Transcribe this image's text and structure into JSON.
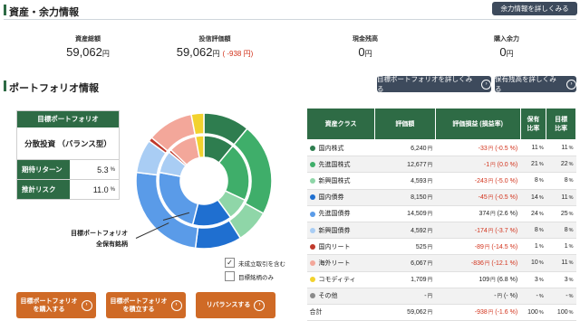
{
  "section1": {
    "title": "資産・余力情報",
    "detail_button": "余力情報を詳しくみる"
  },
  "summary": [
    {
      "label": "資産総額",
      "value": "59,062",
      "unit": "円",
      "extra": ""
    },
    {
      "label": "投信評価額",
      "value": "59,062",
      "unit": "円",
      "extra": "( -938 円)"
    },
    {
      "label": "現金残高",
      "value": "0",
      "unit": "円",
      "extra": ""
    },
    {
      "label": "購入余力",
      "value": "0",
      "unit": "円",
      "extra": ""
    }
  ],
  "section2": {
    "title": "ポートフォリオ情報",
    "detail_button": "目標ポートフォリオを詳しくみる",
    "holdings_button": "保有残高を詳しくみる"
  },
  "target": {
    "header": "目標ポートフォリオ",
    "name": "分散投資 （バランス型）",
    "return_label": "期待リターン",
    "return_value": "5.3",
    "risk_label": "推計リスク",
    "risk_value": "11.0",
    "pct": "%"
  },
  "donut_labels": {
    "outer": "目標ポートフォリオ",
    "inner": "全保有銘柄"
  },
  "checkboxes": [
    {
      "label": "未成立取引を含む",
      "checked": true
    },
    {
      "label": "目標銘柄のみ",
      "checked": false
    }
  ],
  "buttons": {
    "buy": "目標ポートフォリオ\nを購入する",
    "build": "目標ポートフォリオ\nを積立する",
    "rebalance": "リバランスする"
  },
  "table": {
    "headers": [
      "資産クラス",
      "評価額",
      "評価損益 (損益率)",
      "保有\n比率",
      "目標\n比率"
    ],
    "rows": [
      {
        "name": "国内株式",
        "color": "#2e7d4f",
        "amount": "6,240",
        "pl": "-33",
        "rate": "(-0.5 %)",
        "hold": "11",
        "target": "11",
        "neg": true
      },
      {
        "name": "先進国株式",
        "color": "#3fae6a",
        "amount": "12,677",
        "pl": "-1",
        "rate": "(0.0 %)",
        "hold": "21",
        "target": "22",
        "neg": true
      },
      {
        "name": "新興国株式",
        "color": "#8fd6a8",
        "amount": "4,593",
        "pl": "-243",
        "rate": "(-5.0 %)",
        "hold": "8",
        "target": "8",
        "neg": true
      },
      {
        "name": "国内債券",
        "color": "#1f6fd0",
        "amount": "8,150",
        "pl": "-45",
        "rate": "(-0.5 %)",
        "hold": "14",
        "target": "11",
        "neg": true
      },
      {
        "name": "先進国債券",
        "color": "#5a9be8",
        "amount": "14,509",
        "pl": "374",
        "rate": "(2.6 %)",
        "hold": "24",
        "target": "25",
        "neg": false
      },
      {
        "name": "新興国債券",
        "color": "#a9cdf4",
        "amount": "4,592",
        "pl": "-174",
        "rate": "(-3.7 %)",
        "hold": "8",
        "target": "8",
        "neg": true
      },
      {
        "name": "国内リート",
        "color": "#c0392b",
        "amount": "525",
        "pl": "-89",
        "rate": "(-14.5 %)",
        "hold": "1",
        "target": "1",
        "neg": true
      },
      {
        "name": "海外リート",
        "color": "#f3a79a",
        "amount": "6,067",
        "pl": "-836",
        "rate": "(-12.1 %)",
        "hold": "10",
        "target": "11",
        "neg": true
      },
      {
        "name": "コモディティ",
        "color": "#f2d22e",
        "amount": "1,709",
        "pl": "109",
        "rate": "(6.8 %)",
        "hold": "3",
        "target": "3",
        "neg": false
      },
      {
        "name": "その他",
        "color": "#8a8a8a",
        "amount": "-",
        "pl": "-",
        "rate": "(- %)",
        "hold": "-",
        "target": "-",
        "neg": false
      }
    ],
    "total": {
      "name": "合計",
      "amount": "59,062",
      "pl": "-938",
      "rate": "(-1.6 %)",
      "hold": "100",
      "target": "100"
    },
    "yen": "円",
    "pct": "%"
  },
  "chart_data": {
    "type": "pie",
    "categories": [
      "国内株式",
      "先進国株式",
      "新興国株式",
      "国内債券",
      "先進国債券",
      "新興国債券",
      "国内リート",
      "海外リート",
      "コモディティ",
      "その他"
    ],
    "series": [
      {
        "name": "目標ポートフォリオ",
        "values": [
          11,
          22,
          8,
          11,
          25,
          8,
          1,
          11,
          3,
          0
        ]
      },
      {
        "name": "全保有銘柄",
        "values": [
          11,
          21,
          8,
          14,
          24,
          8,
          1,
          10,
          3,
          0
        ]
      }
    ]
  }
}
